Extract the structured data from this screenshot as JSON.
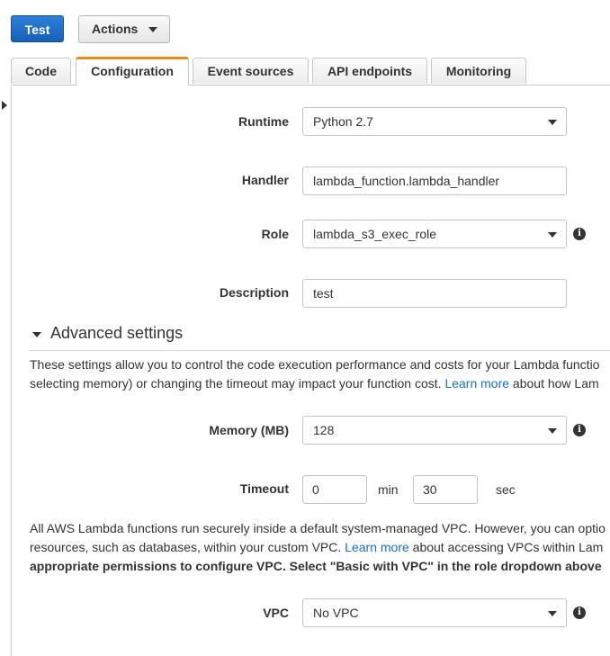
{
  "toolbar": {
    "test_label": "Test",
    "actions_label": "Actions"
  },
  "tabs": [
    {
      "label": "Code"
    },
    {
      "label": "Configuration"
    },
    {
      "label": "Event sources"
    },
    {
      "label": "API endpoints"
    },
    {
      "label": "Monitoring"
    }
  ],
  "form": {
    "runtime_label": "Runtime",
    "runtime_value": "Python 2.7",
    "handler_label": "Handler",
    "handler_value": "lambda_function.lambda_handler",
    "role_label": "Role",
    "role_value": "lambda_s3_exec_role",
    "description_label": "Description",
    "description_value": "test"
  },
  "advanced": {
    "title": "Advanced settings",
    "desc_line1": "These settings allow you to control the code execution performance and costs for your Lambda functio",
    "desc_line2_pre": "selecting memory) or changing the timeout may impact your function cost. ",
    "desc_link": "Learn more",
    "desc_line2_post": " about how Lam",
    "memory_label": "Memory (MB)",
    "memory_value": "128",
    "timeout_label": "Timeout",
    "timeout_min": "0",
    "min_unit": "min",
    "timeout_sec": "30",
    "sec_unit": "sec",
    "vpc_line1": "All AWS Lambda functions run securely inside a default system-managed VPC. However, you can optio",
    "vpc_line2_pre": "resources, such as databases, within your custom VPC. ",
    "vpc_link": "Learn more",
    "vpc_line2_post": " about accessing VPCs within Lam",
    "vpc_line3": "appropriate permissions to configure VPC. Select \"Basic with VPC\" in the role dropdown above",
    "vpc_label": "VPC",
    "vpc_value": "No VPC"
  },
  "icons": {
    "info": "i"
  }
}
